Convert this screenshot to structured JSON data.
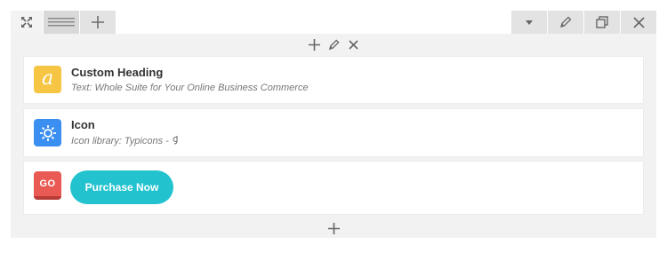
{
  "toolbar": {
    "left_icons": [
      "expand-icon",
      "drag-handle-icon",
      "plus-icon"
    ],
    "right_icons": [
      "caret-down-icon",
      "pencil-icon",
      "duplicate-icon",
      "close-icon"
    ]
  },
  "column_controls": [
    "plus-icon",
    "pencil-icon",
    "close-icon"
  ],
  "elements": [
    {
      "type": "Custom Heading",
      "title": "Custom Heading",
      "subtitle": "Text: Whole Suite for Your Online Business Commerce",
      "badge_letter": "a",
      "badge_color": "#f5c543"
    },
    {
      "type": "Icon",
      "title": "Icon",
      "subtitle": "Icon library: Typicons - ",
      "badge_color": "#3b8ff0"
    },
    {
      "type": "Button",
      "badge_text": "GO",
      "badge_color": "#ea5a55",
      "button_label": "Purchase Now",
      "button_color": "#22c3cf"
    }
  ]
}
